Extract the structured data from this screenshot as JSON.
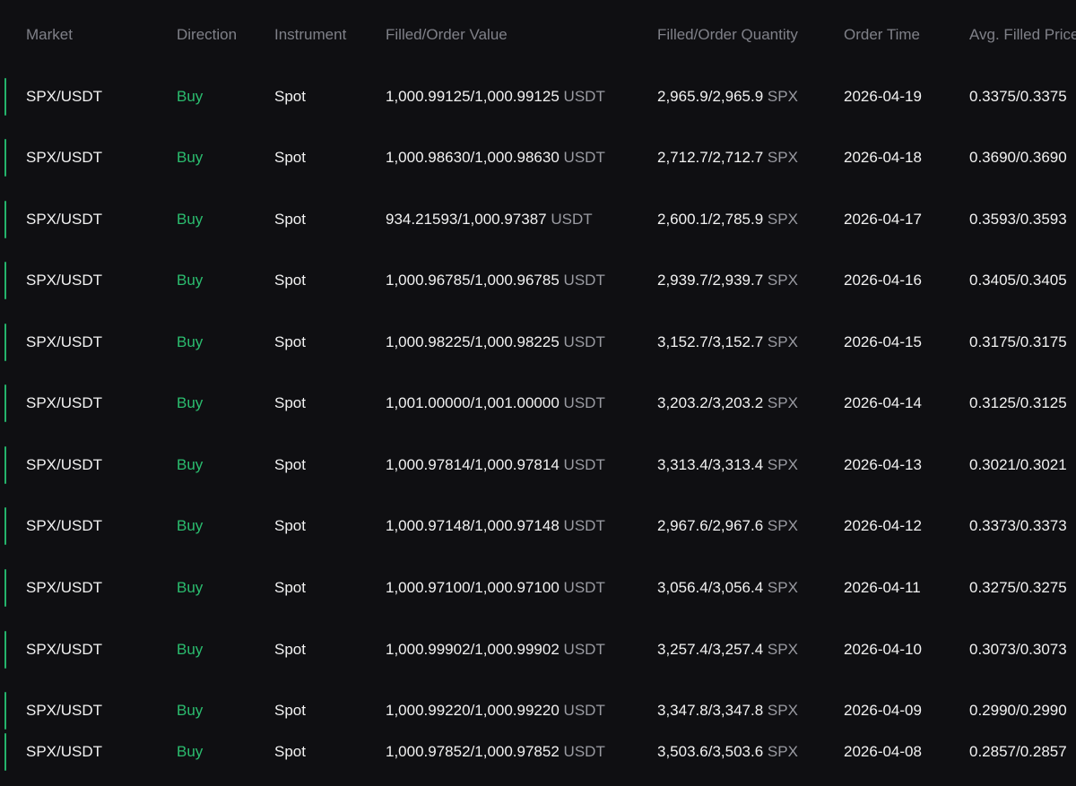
{
  "columns": {
    "market": "Market",
    "direction": "Direction",
    "instrument": "Instrument",
    "value": "Filled/Order Value",
    "quantity": "Filled/Order Quantity",
    "time": "Order Time",
    "avg_price": "Avg. Filled Price"
  },
  "rows": [
    {
      "market": "SPX/USDT",
      "direction": "Buy",
      "instrument": "Spot",
      "value": "1,000.99125/1,000.99125",
      "value_unit": "USDT",
      "quantity": "2,965.9/2,965.9",
      "quantity_unit": "SPX",
      "time": "2026-04-19",
      "avg_price": "0.3375/0.3375"
    },
    {
      "market": "SPX/USDT",
      "direction": "Buy",
      "instrument": "Spot",
      "value": "1,000.98630/1,000.98630",
      "value_unit": "USDT",
      "quantity": "2,712.7/2,712.7",
      "quantity_unit": "SPX",
      "time": "2026-04-18",
      "avg_price": "0.3690/0.3690"
    },
    {
      "market": "SPX/USDT",
      "direction": "Buy",
      "instrument": "Spot",
      "value": "934.21593/1,000.97387",
      "value_unit": "USDT",
      "quantity": "2,600.1/2,785.9",
      "quantity_unit": "SPX",
      "time": "2026-04-17",
      "avg_price": "0.3593/0.3593"
    },
    {
      "market": "SPX/USDT",
      "direction": "Buy",
      "instrument": "Spot",
      "value": "1,000.96785/1,000.96785",
      "value_unit": "USDT",
      "quantity": "2,939.7/2,939.7",
      "quantity_unit": "SPX",
      "time": "2026-04-16",
      "avg_price": "0.3405/0.3405"
    },
    {
      "market": "SPX/USDT",
      "direction": "Buy",
      "instrument": "Spot",
      "value": "1,000.98225/1,000.98225",
      "value_unit": "USDT",
      "quantity": "3,152.7/3,152.7",
      "quantity_unit": "SPX",
      "time": "2026-04-15",
      "avg_price": "0.3175/0.3175"
    },
    {
      "market": "SPX/USDT",
      "direction": "Buy",
      "instrument": "Spot",
      "value": "1,001.00000/1,001.00000",
      "value_unit": "USDT",
      "quantity": "3,203.2/3,203.2",
      "quantity_unit": "SPX",
      "time": "2026-04-14",
      "avg_price": "0.3125/0.3125"
    },
    {
      "market": "SPX/USDT",
      "direction": "Buy",
      "instrument": "Spot",
      "value": "1,000.97814/1,000.97814",
      "value_unit": "USDT",
      "quantity": "3,313.4/3,313.4",
      "quantity_unit": "SPX",
      "time": "2026-04-13",
      "avg_price": "0.3021/0.3021"
    },
    {
      "market": "SPX/USDT",
      "direction": "Buy",
      "instrument": "Spot",
      "value": "1,000.97148/1,000.97148",
      "value_unit": "USDT",
      "quantity": "2,967.6/2,967.6",
      "quantity_unit": "SPX",
      "time": "2026-04-12",
      "avg_price": "0.3373/0.3373"
    },
    {
      "market": "SPX/USDT",
      "direction": "Buy",
      "instrument": "Spot",
      "value": "1,000.97100/1,000.97100",
      "value_unit": "USDT",
      "quantity": "3,056.4/3,056.4",
      "quantity_unit": "SPX",
      "time": "2026-04-11",
      "avg_price": "0.3275/0.3275"
    },
    {
      "market": "SPX/USDT",
      "direction": "Buy",
      "instrument": "Spot",
      "value": "1,000.99902/1,000.99902",
      "value_unit": "USDT",
      "quantity": "3,257.4/3,257.4",
      "quantity_unit": "SPX",
      "time": "2026-04-10",
      "avg_price": "0.3073/0.3073"
    },
    {
      "market": "SPX/USDT",
      "direction": "Buy",
      "instrument": "Spot",
      "value": "1,000.99220/1,000.99220",
      "value_unit": "USDT",
      "quantity": "3,347.8/3,347.8",
      "quantity_unit": "SPX",
      "time": "2026-04-09",
      "avg_price": "0.2990/0.2990"
    },
    {
      "market": "SPX/USDT",
      "direction": "Buy",
      "instrument": "Spot",
      "value": "1,000.97852/1,000.97852",
      "value_unit": "USDT",
      "quantity": "3,503.6/3,503.6",
      "quantity_unit": "SPX",
      "time": "2026-04-08",
      "avg_price": "0.2857/0.2857"
    }
  ],
  "colors": {
    "background": "#0f0f12",
    "header_text": "#7f8088",
    "text": "#f2f2f2",
    "unit_text": "#9a9ba2",
    "buy": "#2bbd6f",
    "row_marker": "#24b36b"
  }
}
